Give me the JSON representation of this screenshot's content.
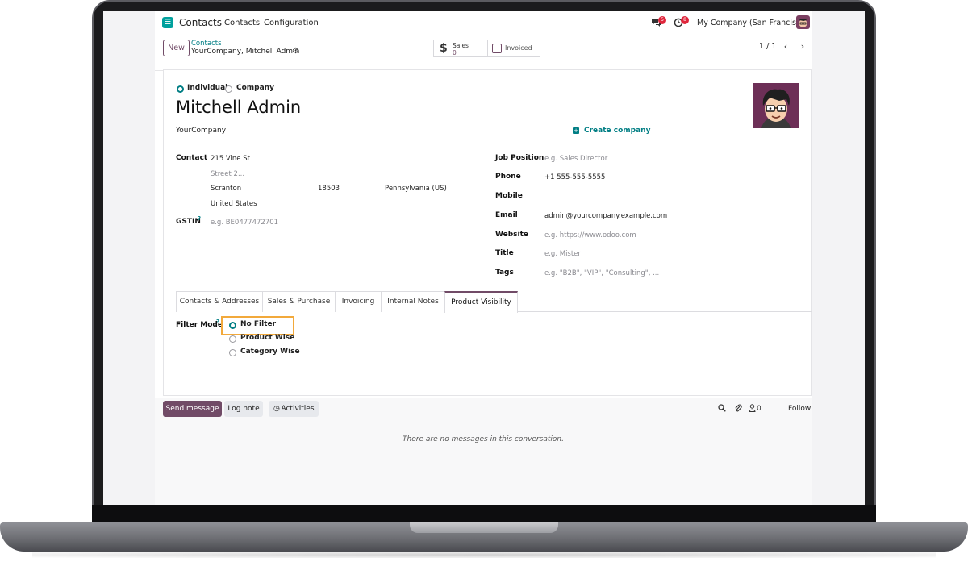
{
  "navbar": {
    "app_name": "Contacts",
    "menu": [
      "Contacts",
      "Configuration"
    ],
    "messages_count": "5",
    "activities_count": "8",
    "company": "My Company (San Francisco)"
  },
  "control": {
    "new_label": "New",
    "breadcrumb_parent": "Contacts",
    "breadcrumb_current": "YourCompany, Mitchell Admin",
    "sales_label": "Sales",
    "sales_value": "0",
    "invoiced_label": "Invoiced",
    "pager": "1 / 1"
  },
  "form": {
    "type_individual": "Individual",
    "type_company": "Company",
    "name": "Mitchell Admin",
    "parent_company": "YourCompany",
    "create_company": "Create company",
    "contact_label": "Contact",
    "street": "215 Vine St",
    "street2_placeholder": "Street 2...",
    "city": "Scranton",
    "zip": "18503",
    "state": "Pennsylvania (US)",
    "country": "United States",
    "gstin_label": "GSTIN",
    "gstin_placeholder": "e.g. BE0477472701",
    "job_label": "Job Position",
    "job_placeholder": "e.g. Sales Director",
    "phone_label": "Phone",
    "phone": "+1 555-555-5555",
    "mobile_label": "Mobile",
    "email_label": "Email",
    "email": "admin@yourcompany.example.com",
    "website_label": "Website",
    "website_placeholder": "e.g. https://www.odoo.com",
    "title_label": "Title",
    "title_placeholder": "e.g. Mister",
    "tags_label": "Tags",
    "tags_placeholder": "e.g. \"B2B\", \"VIP\", \"Consulting\", ..."
  },
  "tabs": [
    "Contacts & Addresses",
    "Sales & Purchase",
    "Invoicing",
    "Internal Notes",
    "Product Visibility"
  ],
  "active_tab": "Product Visibility",
  "product_visibility": {
    "filter_mode_label": "Filter Mode",
    "options": [
      "No Filter",
      "Product Wise",
      "Category Wise"
    ],
    "selected": "No Filter"
  },
  "chatter": {
    "send_message": "Send message",
    "log_note": "Log note",
    "activities": "Activities",
    "followers_count": "0",
    "follow": "Follow",
    "empty": "There are no messages in this conversation."
  },
  "colors": {
    "brand": "#714b67",
    "accent": "#017e84",
    "highlight": "#f2a93b"
  }
}
